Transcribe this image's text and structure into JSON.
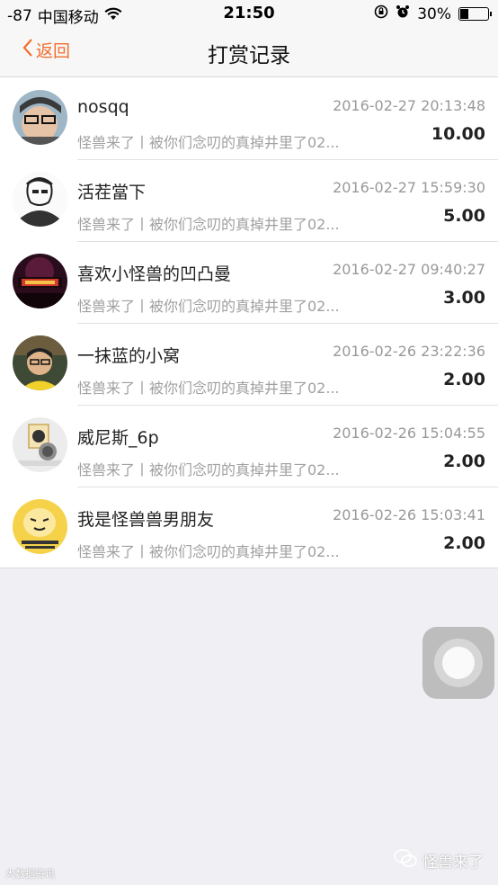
{
  "status_bar": {
    "signal": "-87",
    "carrier": "中国移动",
    "wifi_icon": "wifi-icon",
    "time": "21:50",
    "battery": "30%",
    "battery_level": 0.3
  },
  "nav": {
    "back_label": "返回",
    "title": "打赏记录"
  },
  "records": [
    {
      "name": "nosqq",
      "time": "2016-02-27 20:13:48",
      "desc": "怪兽来了丨被你们念叨的真掉井里了02...",
      "amount": "10.00"
    },
    {
      "name": "活茬當下",
      "time": "2016-02-27 15:59:30",
      "desc": "怪兽来了丨被你们念叨的真掉井里了02...",
      "amount": "5.00"
    },
    {
      "name": "喜欢小怪兽的凹凸曼",
      "time": "2016-02-27 09:40:27",
      "desc": "怪兽来了丨被你们念叨的真掉井里了02...",
      "amount": "3.00"
    },
    {
      "name": "一抹蓝的小窝",
      "time": "2016-02-26 23:22:36",
      "desc": "怪兽来了丨被你们念叨的真掉井里了02...",
      "amount": "2.00"
    },
    {
      "name": "威尼斯_6p",
      "time": "2016-02-26 15:04:55",
      "desc": "怪兽来了丨被你们念叨的真掉井里了02...",
      "amount": "2.00"
    },
    {
      "name": "我是怪兽兽男朋友",
      "time": "2016-02-26 15:03:41",
      "desc": "怪兽来了丨被你们念叨的真掉井里了02...",
      "amount": "2.00"
    }
  ],
  "watermark": "怪兽来了",
  "corner_mark": "大数据资讯",
  "colors": {
    "accent": "#f26d2b"
  }
}
